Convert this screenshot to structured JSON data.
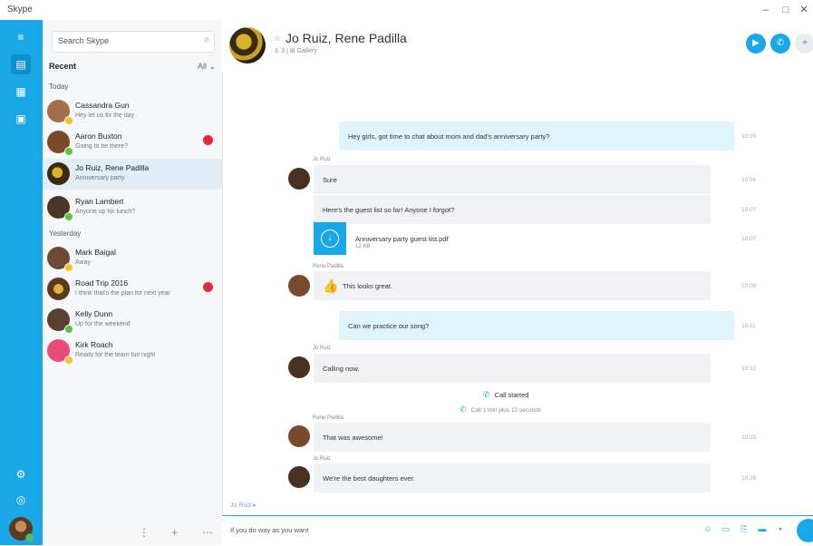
{
  "window": {
    "title": "Skype",
    "controls": [
      "–",
      "□",
      "✕"
    ]
  },
  "rail": {
    "items": [
      "chat-icon",
      "contacts-icon",
      "notifications-icon",
      "settings-icon",
      "help-icon"
    ]
  },
  "sidebar": {
    "search_placeholder": "Search Skype",
    "recent_label": "Recent",
    "recent_right": "All ⌄",
    "groups": {
      "today": "Today",
      "yesterday": "Yesterday"
    },
    "contacts": [
      {
        "name": "Cassandra Gun",
        "message": "Hey let us fix the day",
        "avatar_color": "#a0704a",
        "status": "#f4c22b",
        "badge": false,
        "selected": false
      },
      {
        "name": "Aaron Buxton",
        "message": "Going to be there?",
        "avatar_color": "#7b4a2a",
        "status": "#5cc240",
        "badge": true,
        "selected": false
      },
      {
        "name": "Jo Ruiz, Rene Padilla",
        "message": "Anniversary party",
        "avatar_color": "#c8a02a",
        "status": "",
        "badge": false,
        "selected": true
      },
      {
        "name": "Ryan Lambert",
        "message": "Anyone up for lunch?",
        "avatar_color": "#4a3525",
        "status": "#5cc240",
        "badge": false,
        "selected": false
      },
      {
        "name": "Mark Baigal",
        "message": "Away",
        "avatar_color": "#6b4b36",
        "status": "#f4c22b",
        "badge": false,
        "selected": false
      },
      {
        "name": "Road Trip 2016",
        "message": "I think that's the plan for next year",
        "avatar_color": "#8a5a2a",
        "status": "",
        "badge": true,
        "selected": false
      },
      {
        "name": "Kelly Dunn",
        "message": "Up for the weekend",
        "avatar_color": "#5a4030",
        "status": "#5cc240",
        "badge": false,
        "selected": false
      },
      {
        "name": "Kirk Roach",
        "message": "Ready for the team fun night",
        "avatar_color": "#e84a7a",
        "status": "#f4c22b",
        "badge": false,
        "selected": false
      }
    ],
    "bottom_icons": [
      "⋮",
      "+",
      "⋯"
    ]
  },
  "chat": {
    "title": "Jo Ruiz, Rene Padilla",
    "subtitle": "♙ 3  |  ⊞ Gallery",
    "messages": [
      {
        "type": "out",
        "text": "Hey girls, got time to chat about mom and dad's anniversary party?",
        "time": "10:05"
      },
      {
        "type": "sender",
        "text": "Jo Ruiz"
      },
      {
        "type": "in",
        "text": "Sure",
        "time": "10:06"
      },
      {
        "type": "in",
        "text": "Here's the guest list so far! Anyone I forgot?",
        "time": "10:07"
      },
      {
        "type": "file",
        "text": "Anniversary party guest list.pdf",
        "sub": "12 KB",
        "time": "10:07"
      },
      {
        "type": "sender",
        "text": "Rene Padilla"
      },
      {
        "type": "in",
        "text": "This looks great.",
        "time": "10:09"
      },
      {
        "type": "out",
        "text": "Can we practice our song?",
        "time": "10:11"
      },
      {
        "type": "sender",
        "text": "Jo Ruiz"
      },
      {
        "type": "in",
        "text": "Calling now.",
        "time": "10:12"
      },
      {
        "type": "call",
        "text": "Call started"
      },
      {
        "type": "call",
        "text": "Call 1 min plus 12 seconds"
      },
      {
        "type": "sender",
        "text": "Rene Padilla"
      },
      {
        "type": "in",
        "text": "That was awesome!",
        "time": "10:25"
      },
      {
        "type": "sender",
        "text": "Jo Ruiz"
      },
      {
        "type": "in",
        "text": "We're the best daughters ever.",
        "time": "10:26"
      }
    ],
    "composer_hint": "Jo Ruiz ▸",
    "composer_placeholder": "If you do way as you want"
  }
}
